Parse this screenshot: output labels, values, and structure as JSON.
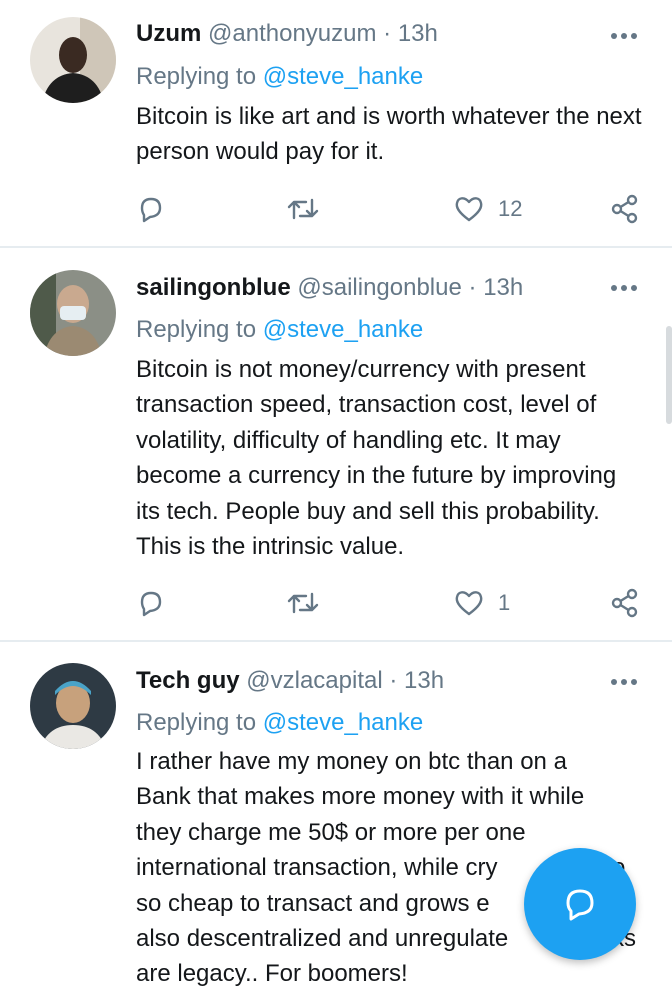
{
  "tweets": [
    {
      "name": "Uzum",
      "handle": "@anthonyuzum",
      "separator": "·",
      "time": "13h",
      "replying_prefix": "Replying to",
      "replying_to": "@steve_hanke",
      "text": "Bitcoin is like art and is worth whatever the next person would pay for it.",
      "like_count": "12",
      "avatar_icon": "user-avatar-photo"
    },
    {
      "name": "sailingonblue",
      "handle": "@sailingonblue",
      "separator": "·",
      "time": "13h",
      "replying_prefix": "Replying to",
      "replying_to": "@steve_hanke",
      "text": "Bitcoin is not money/currency with present transaction speed, transaction cost, level of volatility, difficulty of handling etc. It may become a currency in the future by improving its tech. People buy and sell this probability. This is the intrinsic value.",
      "like_count": "1",
      "avatar_icon": "user-avatar-photo"
    },
    {
      "name": "Tech guy",
      "handle": "@vzlacapital",
      "separator": "·",
      "time": "13h",
      "replying_prefix": "Replying to",
      "replying_to": "@steve_hanke",
      "text_lines": [
        "I rather have my money on btc than on a",
        "Bank that makes more money with it while",
        "they charge me 50$ or more per one",
        "international transaction, while cry",
        "so cheap to transact and grows e",
        "also descentralized and unregulate",
        "are legacy.. For boomers!"
      ],
      "text_tails": [
        "",
        "",
        "",
        "",
        "",
        "",
        ""
      ],
      "text_line3_tail": "o",
      "text_line5_tail": "ks",
      "avatar_icon": "user-avatar-photo"
    }
  ],
  "icons": {
    "reply": "reply-icon",
    "retweet": "retweet-icon",
    "like": "heart-icon",
    "share": "share-icon",
    "more": "more-options-icon",
    "compose": "compose-reply-icon"
  },
  "colors": {
    "accent": "#1da1f2",
    "secondary_text": "#657786",
    "divider": "#e6ecf0"
  }
}
